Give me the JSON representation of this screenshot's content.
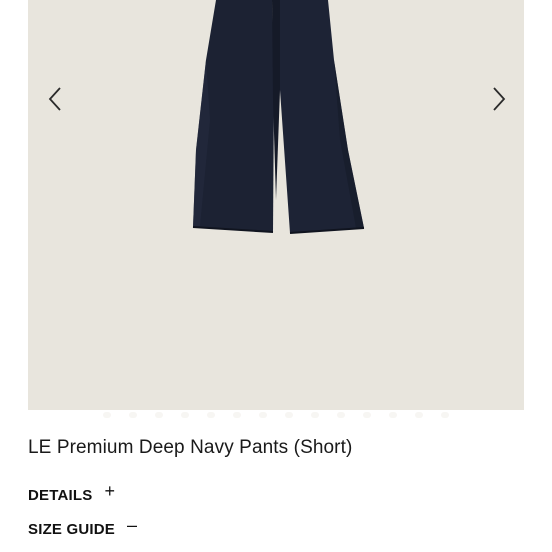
{
  "gallery": {
    "image_alt": "navy wide-leg pants on beige background",
    "prev_icon": "chevron-left-icon",
    "next_icon": "chevron-right-icon",
    "background_color": "#e8e5dd",
    "product_color": "#1c2233",
    "dot_count": 14
  },
  "product": {
    "title": "LE Premium Deep Navy Pants (Short)"
  },
  "accordions": {
    "details": {
      "label": "DETAILS",
      "sign": "+",
      "icon": "plus-icon"
    },
    "size_guide": {
      "label": "SIZE GUIDE",
      "sign": "–",
      "icon": "minus-icon"
    }
  }
}
